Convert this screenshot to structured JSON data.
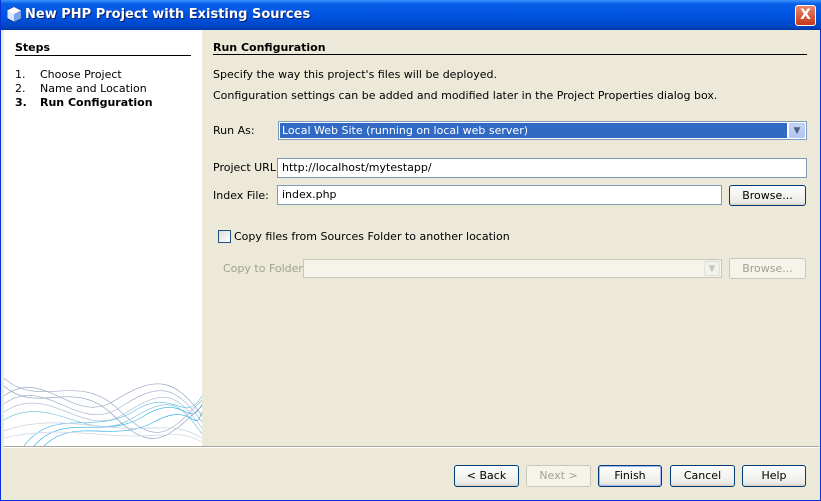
{
  "window": {
    "title": "New PHP Project with Existing Sources",
    "close_label": "X"
  },
  "steps": {
    "title": "Steps",
    "items": [
      {
        "num": "1.",
        "label": "Choose Project"
      },
      {
        "num": "2.",
        "label": "Name and Location"
      },
      {
        "num": "3.",
        "label": "Run Configuration"
      }
    ]
  },
  "content": {
    "title": "Run Configuration",
    "desc1": "Specify the way this project's files will be deployed.",
    "desc2": "Configuration settings can be added and modified later in the Project Properties dialog box.",
    "run_as": {
      "label": "Run As:",
      "value": "Local Web Site (running on local web server)"
    },
    "project_url": {
      "label": "Project URL:",
      "value": "http://localhost/mytestapp/"
    },
    "index_file": {
      "label": "Index File:",
      "value": "index.php",
      "browse_label": "Browse..."
    },
    "copy_files": {
      "label": "Copy files from Sources Folder to another location",
      "checked": false
    },
    "copy_to": {
      "label": "Copy to Folder:",
      "value": "",
      "browse_label": "Browse..."
    }
  },
  "buttons": {
    "back": "< Back",
    "next": "Next >",
    "finish": "Finish",
    "cancel": "Cancel",
    "help": "Help"
  },
  "colors": {
    "title_bar": "#0054e3",
    "selection": "#316ac5",
    "dialog_bg": "#ece9d8"
  }
}
